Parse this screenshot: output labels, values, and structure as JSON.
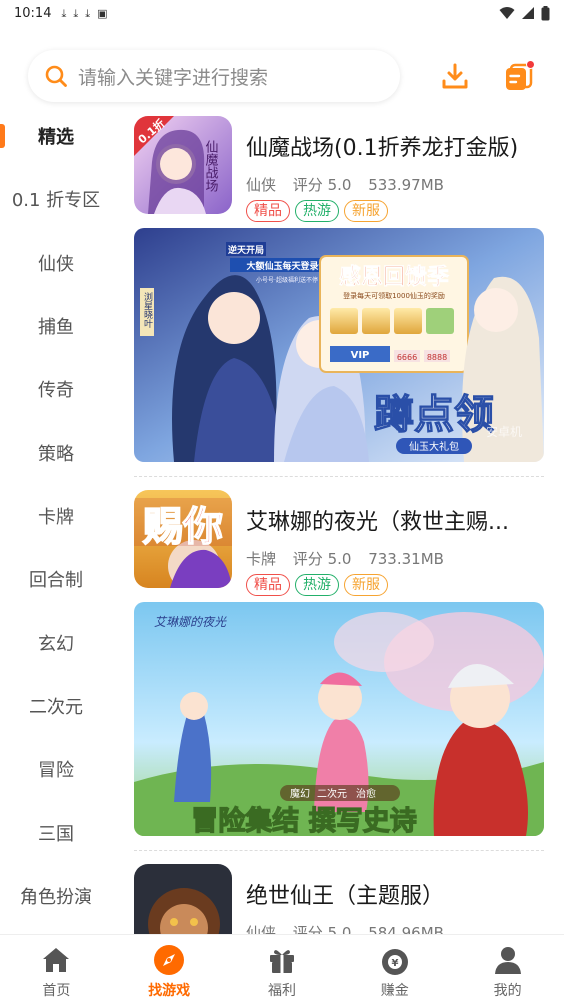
{
  "status_bar": {
    "time": "10:14",
    "notification_icons": [
      "download-icon",
      "download-icon",
      "download-icon",
      "a-icon"
    ]
  },
  "search": {
    "placeholder": "请输入关键字进行搜索"
  },
  "sidebar": {
    "items": [
      {
        "label": "精选",
        "active": true
      },
      {
        "label": "0.1 折专区"
      },
      {
        "label": "仙侠"
      },
      {
        "label": "捕鱼"
      },
      {
        "label": "传奇"
      },
      {
        "label": "策略"
      },
      {
        "label": "卡牌"
      },
      {
        "label": "回合制"
      },
      {
        "label": "玄幻"
      },
      {
        "label": "二次元"
      },
      {
        "label": "冒险"
      },
      {
        "label": "三国"
      },
      {
        "label": "角色扮演"
      }
    ]
  },
  "games": [
    {
      "title": "仙魔战场(0.1折养龙打金版)",
      "category": "仙侠",
      "rating": "评分 5.0",
      "size": "533.97MB",
      "tags": [
        "精品",
        "热游",
        "新服"
      ],
      "thumb_text": "0.1折",
      "thumb_title": "仙魔战场",
      "banner": {
        "badge": "逆天开局",
        "line1": "大额仙玉每天登录领",
        "line2": "小号号·超级福利送不停",
        "side_text": "浏星晓叶",
        "event_title": "感恩回馈季",
        "event_sub": "登录每天可领取1000仙玉的奖励",
        "vip_label": "VIP",
        "reward_values": [
          "6666",
          "8888"
        ],
        "headline": "蹲点领",
        "sub_headline": "仙玉大礼包",
        "watermark": "安卓机"
      }
    },
    {
      "title": "艾琳娜的夜光（救世主赐...",
      "category": "卡牌",
      "rating": "评分 5.0",
      "size": "733.31MB",
      "tags": [
        "精品",
        "热游",
        "新服"
      ],
      "thumb_text": "赐你",
      "banner": {
        "logo_text": "艾琳娜的夜光",
        "chips": [
          "魔幻",
          "二次元",
          "治愈"
        ],
        "headline": "冒险集结 撰写史诗"
      }
    },
    {
      "title": "绝世仙王（主题服）",
      "category": "仙侠",
      "rating": "评分 5.0",
      "size": "584.96MB"
    }
  ],
  "bottom_nav": [
    {
      "label": "首页",
      "icon": "home-icon"
    },
    {
      "label": "找游戏",
      "icon": "compass-icon",
      "active": true
    },
    {
      "label": "福利",
      "icon": "gift-icon"
    },
    {
      "label": "赚金",
      "icon": "money-bag-icon"
    },
    {
      "label": "我的",
      "icon": "user-icon"
    }
  ],
  "colors": {
    "accent": "#ff7a1a",
    "tag_red": "#f0504a",
    "tag_green": "#23b06a",
    "tag_orange": "#f6a432"
  }
}
